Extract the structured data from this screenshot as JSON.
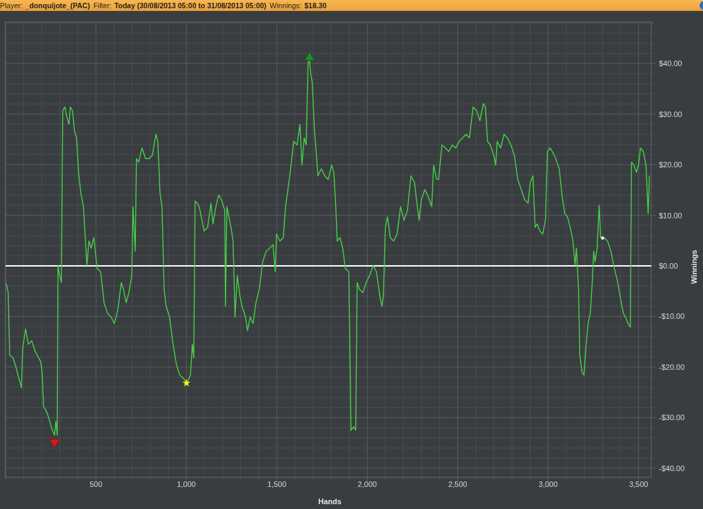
{
  "header": {
    "fields": [
      {
        "label": "Player:",
        "value": "_donquijote_(PAC)"
      },
      {
        "label": "Filter:",
        "value": "Today (30/08/2013 05:00 to 31/08/2013 05:00)"
      },
      {
        "label": "Winnings:",
        "value": "$18.30"
      }
    ]
  },
  "chart": {
    "chart_data": {
      "type": "line",
      "xlabel": "Hands",
      "ylabel": "Winnings",
      "grid": true,
      "xlim": [
        0,
        3570
      ],
      "ylim": [
        -41.8,
        48.2
      ],
      "xticks": [
        {
          "value": 500,
          "label": "500"
        },
        {
          "value": 1000,
          "label": "1,000"
        },
        {
          "value": 1500,
          "label": "1,500"
        },
        {
          "value": 2000,
          "label": "2,000"
        },
        {
          "value": 2500,
          "label": "2,500"
        },
        {
          "value": 3000,
          "label": "3,000"
        },
        {
          "value": 3500,
          "label": "3,500"
        }
      ],
      "yticks": [
        {
          "value": 40,
          "label": "$40.00"
        },
        {
          "value": 30,
          "label": "$30.00"
        },
        {
          "value": 20,
          "label": "$20.00"
        },
        {
          "value": 10,
          "label": "$10.00"
        },
        {
          "value": 0,
          "label": "$0.00"
        },
        {
          "value": -10,
          "label": "-$10.00"
        },
        {
          "value": -20,
          "label": "-$20.00"
        },
        {
          "value": -30,
          "label": "-$30.00"
        },
        {
          "value": -40,
          "label": "-$40.00"
        }
      ],
      "x": [
        4,
        15,
        23,
        42,
        57,
        72,
        88,
        95,
        111,
        126,
        145,
        164,
        183,
        194,
        202,
        210,
        221,
        233,
        244,
        259,
        271,
        278,
        286,
        290,
        297,
        309,
        316,
        328,
        339,
        351,
        358,
        370,
        381,
        393,
        404,
        416,
        431,
        442,
        450,
        461,
        473,
        488,
        507,
        526,
        545,
        564,
        583,
        602,
        621,
        640,
        652,
        667,
        682,
        698,
        705,
        717,
        724,
        736,
        755,
        774,
        793,
        812,
        831,
        842,
        854,
        865,
        877,
        888,
        907,
        926,
        945,
        964,
        984,
        1003,
        1022,
        1033,
        1041,
        1048,
        1060,
        1071,
        1086,
        1098,
        1117,
        1136,
        1147,
        1163,
        1178,
        1193,
        1212,
        1216,
        1224,
        1235,
        1247,
        1258,
        1269,
        1281,
        1296,
        1308,
        1327,
        1338,
        1353,
        1369,
        1384,
        1403,
        1422,
        1441,
        1460,
        1479,
        1491,
        1498,
        1517,
        1536,
        1548,
        1559,
        1574,
        1593,
        1612,
        1628,
        1639,
        1651,
        1662,
        1673,
        1681,
        1689,
        1696,
        1708,
        1719,
        1727,
        1746,
        1765,
        1784,
        1803,
        1815,
        1826,
        1834,
        1849,
        1864,
        1879,
        1898,
        1910,
        1925,
        1936,
        1944,
        1956,
        1975,
        1994,
        2013,
        2032,
        2051,
        2070,
        2081,
        2089,
        2100,
        2112,
        2127,
        2146,
        2165,
        2184,
        2203,
        2222,
        2241,
        2261,
        2272,
        2287,
        2299,
        2318,
        2337,
        2356,
        2367,
        2383,
        2394,
        2413,
        2432,
        2451,
        2470,
        2489,
        2508,
        2527,
        2546,
        2565,
        2585,
        2604,
        2623,
        2642,
        2653,
        2665,
        2680,
        2699,
        2710,
        2718,
        2737,
        2756,
        2775,
        2794,
        2813,
        2832,
        2851,
        2870,
        2889,
        2901,
        2916,
        2928,
        2939,
        2954,
        2970,
        2985,
        2996,
        3011,
        3023,
        3042,
        3061,
        3080,
        3092,
        3107,
        3122,
        3137,
        3149,
        3156,
        3168,
        3175,
        3187,
        3198,
        3210,
        3221,
        3233,
        3244,
        3252,
        3259,
        3271,
        3282,
        3290,
        3309,
        3328,
        3347,
        3366,
        3385,
        3404,
        3416,
        3427,
        3442,
        3454,
        3461,
        3473,
        3488,
        3499,
        3511,
        3526,
        3541,
        3553,
        3560
      ],
      "series": [
        {
          "color": "#47d147",
          "values": [
            -3.5,
            -5.3,
            -17.6,
            -18.2,
            -19.9,
            -22.0,
            -24.1,
            -16.2,
            -12.5,
            -15.5,
            -14.8,
            -16.9,
            -18.2,
            -18.9,
            -21.0,
            -27.8,
            -28.4,
            -29.4,
            -30.7,
            -32.5,
            -33.5,
            -30.7,
            -33.5,
            0.1,
            -1.6,
            -3.3,
            30.7,
            31.4,
            29.4,
            28.0,
            31.4,
            30.7,
            26.7,
            25.3,
            18.5,
            14.4,
            11.7,
            4.9,
            0.1,
            4.9,
            3.5,
            5.6,
            -0.5,
            -1.2,
            -7.3,
            -9.4,
            -10.1,
            -11.4,
            -8.7,
            -3.3,
            -4.6,
            -7.3,
            -5.3,
            -1.9,
            11.7,
            2.9,
            21.2,
            20.5,
            23.3,
            21.2,
            21.2,
            21.9,
            26.0,
            24.6,
            14.4,
            11.7,
            -4.6,
            -8.0,
            -10.1,
            -15.5,
            -19.6,
            -21.6,
            -22.3,
            -23.1,
            -21.6,
            -15.5,
            -18.2,
            12.8,
            12.4,
            11.7,
            9.0,
            6.9,
            7.6,
            12.4,
            8.3,
            11.7,
            14.0,
            13.1,
            11.0,
            -8.0,
            11.7,
            9.7,
            7.6,
            4.9,
            -10.1,
            -1.9,
            -6.0,
            -8.0,
            -10.1,
            -12.8,
            -10.1,
            -11.4,
            -7.3,
            -4.6,
            0.8,
            2.9,
            3.5,
            4.2,
            -1.2,
            6.3,
            4.9,
            5.6,
            11.7,
            14.4,
            18.5,
            24.6,
            23.9,
            28.0,
            19.9,
            25.3,
            23.9,
            40.3,
            40.5,
            37.6,
            36.2,
            26.7,
            21.9,
            17.8,
            19.2,
            17.8,
            17.1,
            19.9,
            18.5,
            11.7,
            4.9,
            5.6,
            3.5,
            -0.5,
            -1.2,
            -32.5,
            -31.8,
            -32.5,
            -3.3,
            -4.6,
            -5.3,
            -3.3,
            -1.9,
            0.1,
            -1.2,
            -6.0,
            -8.0,
            -6.0,
            7.6,
            9.7,
            5.6,
            4.9,
            6.3,
            11.7,
            9.0,
            11.0,
            17.8,
            16.5,
            13.1,
            9.0,
            13.1,
            15.1,
            13.7,
            11.7,
            19.9,
            17.1,
            17.1,
            23.9,
            23.3,
            22.6,
            23.9,
            23.3,
            24.6,
            25.3,
            26.0,
            25.3,
            31.4,
            30.7,
            28.7,
            32.1,
            31.4,
            24.6,
            23.9,
            21.9,
            19.9,
            24.6,
            23.3,
            26.0,
            25.3,
            23.9,
            21.9,
            17.1,
            15.1,
            13.1,
            12.4,
            16.5,
            17.8,
            7.6,
            8.3,
            6.9,
            6.3,
            9.0,
            22.6,
            23.3,
            22.6,
            21.2,
            19.2,
            13.1,
            10.3,
            9.7,
            7.6,
            4.9,
            0.1,
            3.5,
            -4.6,
            -17.6,
            -21.0,
            -21.6,
            -15.5,
            -11.4,
            -9.4,
            -3.3,
            2.9,
            0.8,
            3.5,
            12.0,
            5.6,
            5.6,
            4.9,
            2.9,
            -0.5,
            -3.3,
            -7.3,
            -9.4,
            -10.1,
            -11.4,
            -12.1,
            20.5,
            19.9,
            18.5,
            19.9,
            23.3,
            22.6,
            19.9,
            10.3,
            17.8
          ]
        }
      ],
      "annotations": [
        {
          "text": "★",
          "x": 1000,
          "y": -23.1
        },
        {
          "text": "•",
          "x": 3301,
          "y": 5.3
        }
      ]
    }
  }
}
